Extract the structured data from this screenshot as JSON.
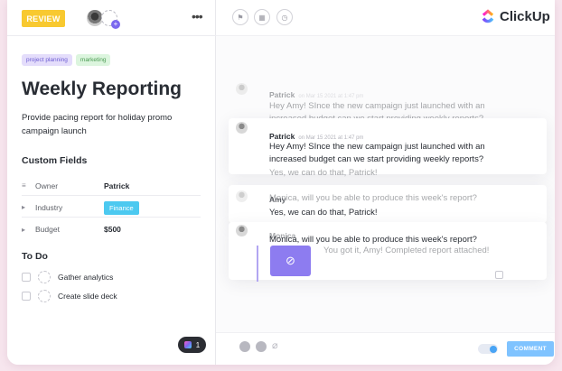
{
  "left": {
    "status_label": "REVIEW",
    "more_label": "•••",
    "tags": [
      "project planning",
      "marketing"
    ],
    "title": "Weekly Reporting",
    "description": "Provide pacing report for holiday promo campaign launch",
    "custom_fields_heading": "Custom Fields",
    "fields": [
      {
        "label": "Owner",
        "value": "Patrick",
        "icon": "person-icon"
      },
      {
        "label": "Industry",
        "value": "Finance",
        "icon": "dropdown-icon"
      },
      {
        "label": "Budget",
        "value": "$500",
        "icon": "money-icon"
      }
    ],
    "todo_heading": "To Do",
    "todos": [
      "Gather analytics",
      "Create slide deck"
    ],
    "notification_count": "1"
  },
  "right": {
    "brand": "ClickUp",
    "comment_button": "COMMENT",
    "messages": [
      {
        "author": "Patrick",
        "meta": "on Mar 15 2021 at 1:47 pm",
        "text": "Hey Amy! SInce the new campaign just launched with an increased budget can we start providing weekly reports?"
      },
      {
        "author": "Patrick",
        "meta": "on Mar 15 2021 at 1:47 pm",
        "text": "Hey Amy! SInce the new campaign just launched with an increased budget can we start providing weekly reports?"
      },
      {
        "author": "Amy",
        "meta": "",
        "text": "Yes, we can do that, Patrick!"
      },
      {
        "text_faded": "Monica, will you be able to produce this week's report?"
      },
      {
        "author": "Amy",
        "meta": "",
        "text": "Yes, we can do that, Patrick!"
      },
      {
        "author": "Monica",
        "meta": "",
        "text": "Monica, will you be able to produce this week's report?"
      },
      {
        "text": "You got it, Amy! Completed report attached!"
      }
    ]
  }
}
